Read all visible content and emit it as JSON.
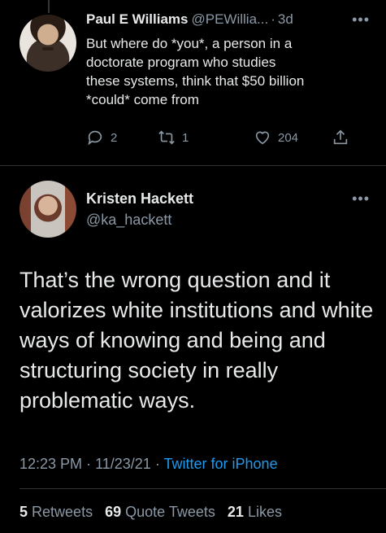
{
  "reply_tweet": {
    "name": "Paul E Williams",
    "handle": "@PEWillia...",
    "separator": "·",
    "time": "3d",
    "text": "But where do *you*, a person in a\ndoctorate program who studies\nthese systems, think that $50 billion\n*could* come from",
    "replies": "2",
    "retweets": "1",
    "likes": "204"
  },
  "main_tweet": {
    "name": "Kristen Hackett",
    "handle": "@ka_hackett",
    "text": "That’s the wrong question and it valorizes white institutions and white ways of knowing and being and structuring society in really problematic ways.",
    "time": "12:23 PM",
    "date_sep": "·",
    "date": "11/23/21",
    "source_sep": "·",
    "source": "Twitter for iPhone",
    "retweets_count": "5",
    "retweets_label": "Retweets",
    "quote_count": "69",
    "quote_label": "Quote Tweets",
    "likes_count": "21",
    "likes_label": "Likes"
  },
  "icons": {
    "reply": "speech-bubble-icon",
    "retweet": "retweet-arrows-icon",
    "like": "heart-icon",
    "share": "share-upload-icon",
    "more": "ellipsis-icon"
  },
  "colors": {
    "background": "#000000",
    "text": "#e7e9ea",
    "muted": "#8b98a5",
    "link": "#1d9bf0"
  }
}
